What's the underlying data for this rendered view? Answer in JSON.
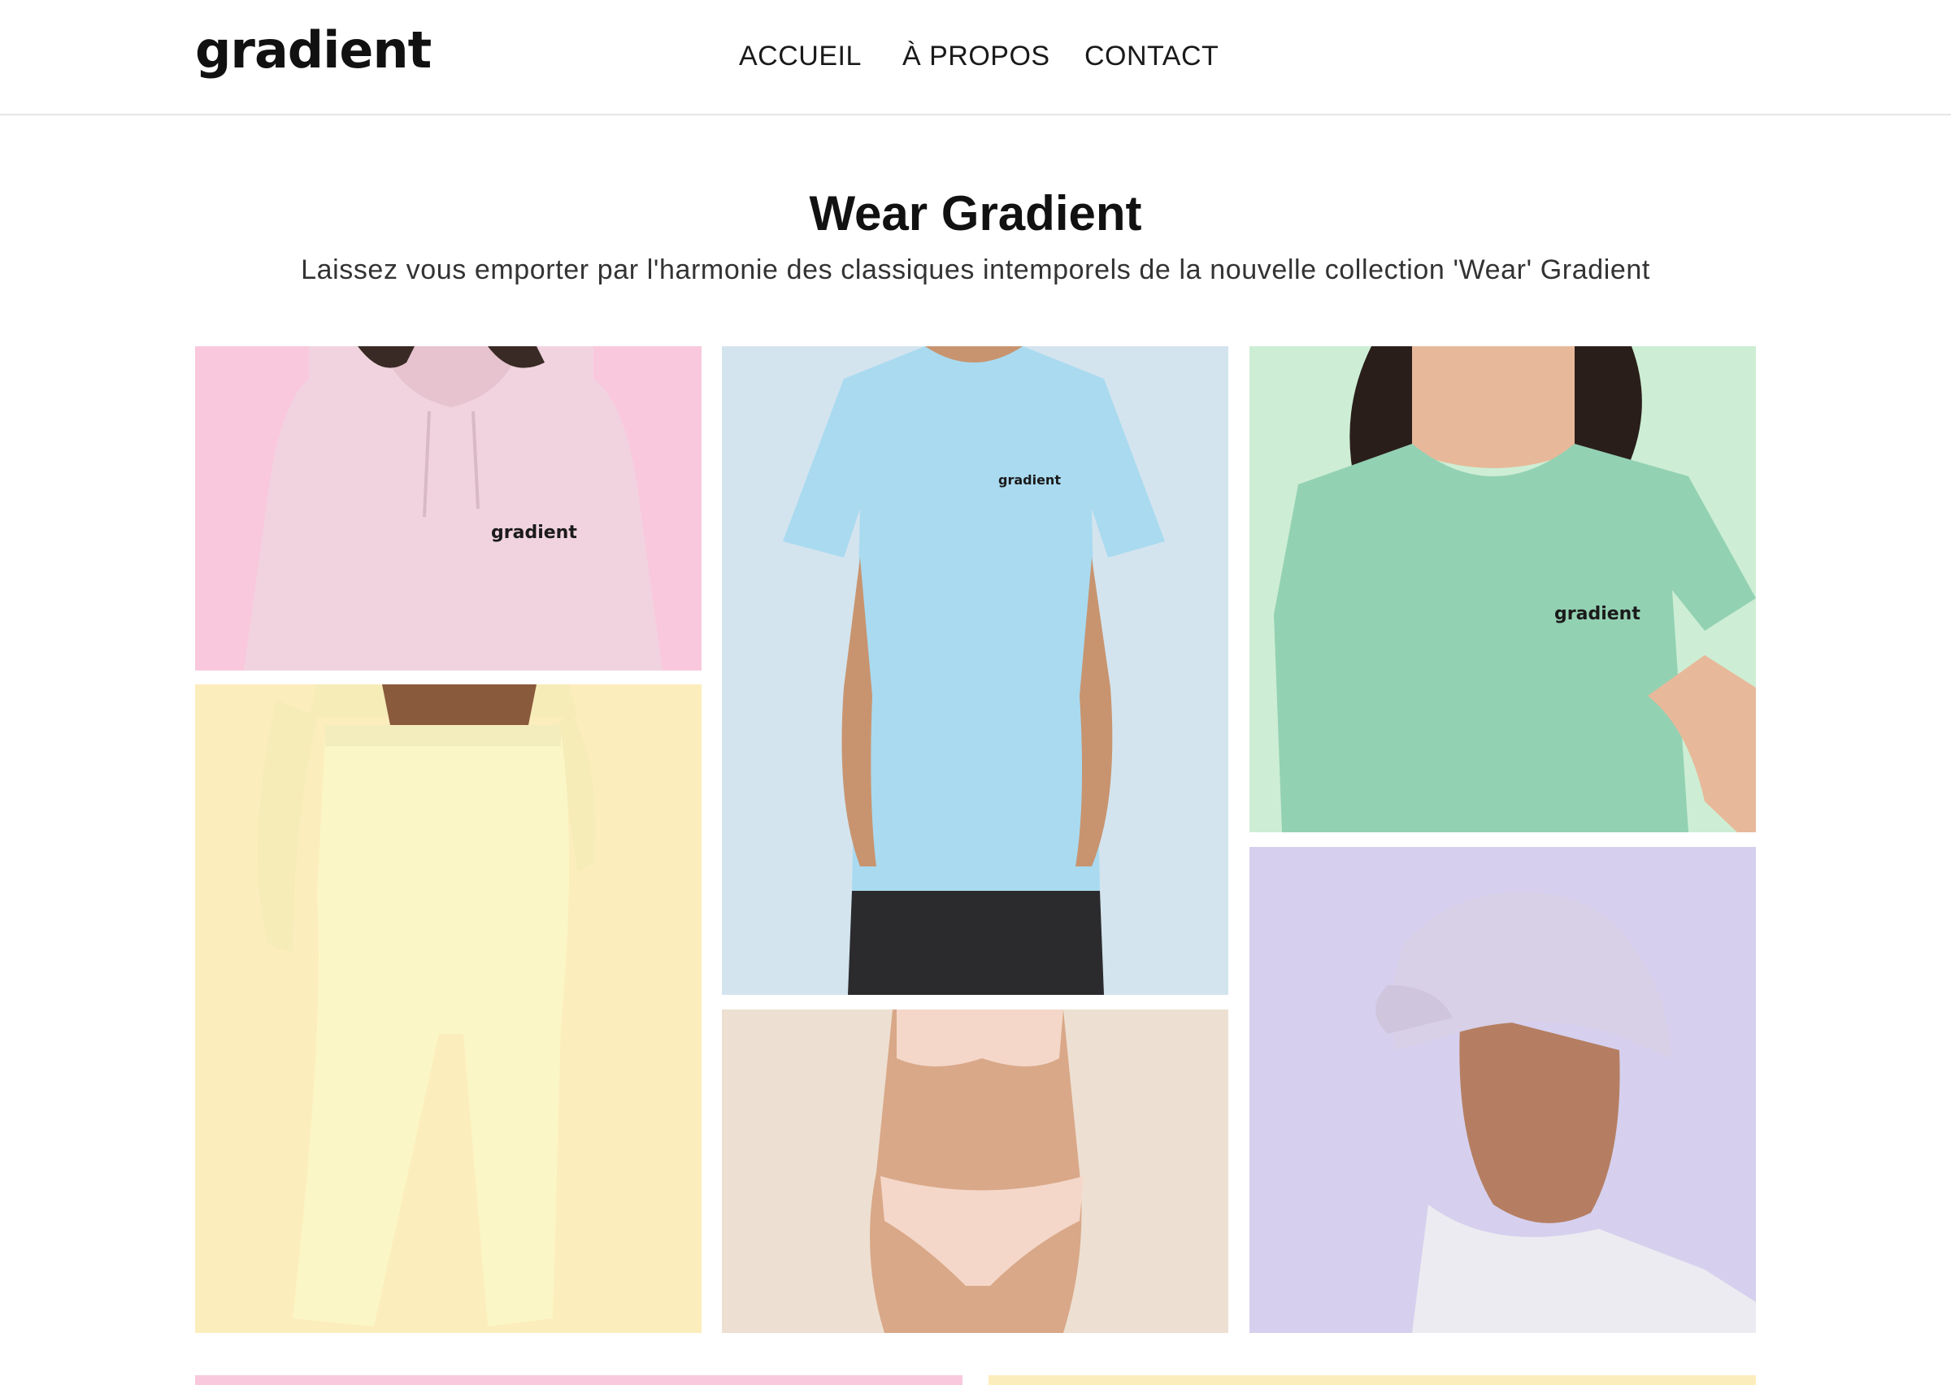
{
  "header": {
    "logo": "gradient",
    "nav": [
      {
        "label": "ACCUEIL"
      },
      {
        "label": "À PROPOS"
      },
      {
        "label": "CONTACT"
      }
    ]
  },
  "hero": {
    "title": "Wear Gradient",
    "subtitle": "Laissez vous emporter par l'harmonie des classiques intemporels de la nouvelle collection 'Wear' Gradient"
  },
  "gallery": {
    "shirt_logo": "gradient",
    "tiles": [
      {
        "name": "pink-hoodie",
        "color": "#f9c8dc",
        "garment": "#f1d3df"
      },
      {
        "name": "blue-tshirt",
        "color": "#d3e4ee",
        "garment": "#a9daf0"
      },
      {
        "name": "green-tshirt",
        "color": "#cdeed4",
        "garment": "#93d1b3"
      },
      {
        "name": "yellow-joggers",
        "color": "#fcedbc",
        "garment": "#fbf6c6"
      },
      {
        "name": "beige-underwear",
        "color": "#ede0d2",
        "garment": "#f4d7c8"
      },
      {
        "name": "lavender-cap",
        "color": "#d6d0ee",
        "garment": "#d7d0e6"
      },
      {
        "name": "pink-banner",
        "color": "#f9c8dc"
      },
      {
        "name": "yellow-banner",
        "color": "#fcedbc"
      }
    ]
  }
}
